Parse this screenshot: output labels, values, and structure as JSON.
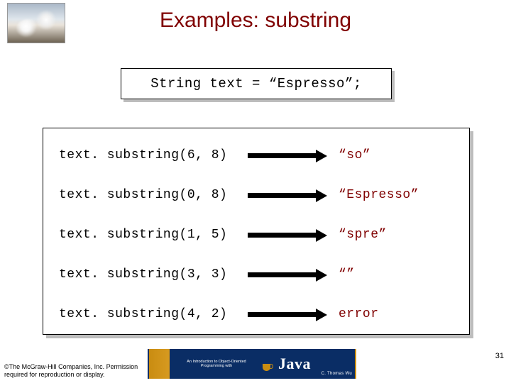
{
  "title": "Examples: substring",
  "declaration": "String text = “Espresso”;",
  "rows": [
    {
      "expr": "text. substring(6, 8)",
      "result": "“so”"
    },
    {
      "expr": "text. substring(0, 8)",
      "result": "“Espresso”"
    },
    {
      "expr": "text. substring(1, 5)",
      "result": "“spre”"
    },
    {
      "expr": "text. substring(3, 3)",
      "result": "“”"
    },
    {
      "expr": "text. substring(4, 2)",
      "result": "error"
    }
  ],
  "footer": {
    "copyright": "©The McGraw-Hill Companies, Inc. Permission required for reproduction or display.",
    "page_number": "31",
    "banner_intro": "An Introduction to\nObject-Oriented\nProgramming with",
    "banner_java": "Java",
    "banner_author": "C. Thomas Wu"
  }
}
